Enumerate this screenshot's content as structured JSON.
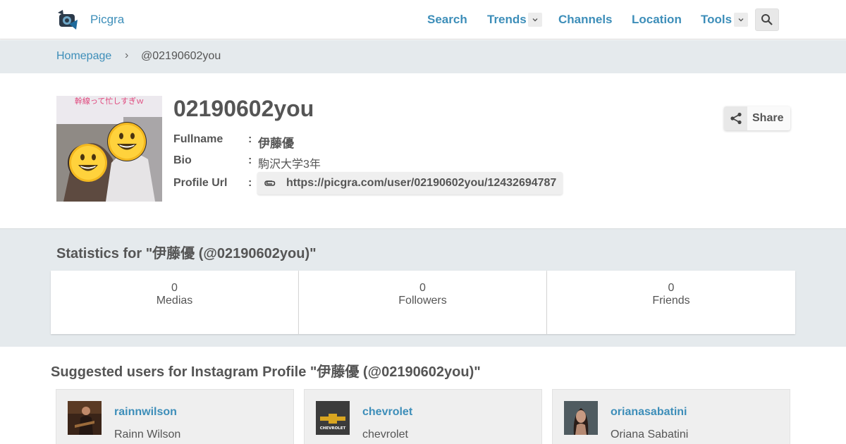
{
  "nav": {
    "brand": "Picgra",
    "items": [
      {
        "label": "Search"
      },
      {
        "label": "Trends"
      },
      {
        "label": "Channels"
      },
      {
        "label": "Location"
      },
      {
        "label": "Tools"
      }
    ]
  },
  "breadcrumb": {
    "home": "Homepage",
    "separator": "›",
    "current": "@02190602you"
  },
  "profile": {
    "username": "02190602you",
    "avatar_caption": "幹線って忙しすぎｗ",
    "fields": [
      {
        "label": "Fullname",
        "value": "伊藤優"
      },
      {
        "label": "Bio",
        "value": "駒沢大学3年"
      },
      {
        "label": "Profile Url",
        "value": "https://picgra.com/user/02190602you/12432694787"
      }
    ],
    "colon": ":",
    "share_label": "Share"
  },
  "statistics": {
    "title": "Statistics for \"伊藤優 (@02190602you)\"",
    "items": [
      {
        "value": "0",
        "label": "Medias"
      },
      {
        "value": "0",
        "label": "Followers"
      },
      {
        "value": "0",
        "label": "Friends"
      }
    ]
  },
  "suggested": {
    "title": "Suggested users for Instagram Profile \"伊藤優 (@02190602you)\"",
    "users": [
      {
        "username": "rainnwilson",
        "fullname": "Rainn Wilson"
      },
      {
        "username": "chevrolet",
        "fullname": "chevrolet",
        "thumb_text": "CHEVROLET"
      },
      {
        "username": "orianasabatini",
        "fullname": "Oriana Sabatini"
      }
    ]
  },
  "colors": {
    "link": "#3d8eb9",
    "text": "#555555",
    "band": "#e5eaed"
  }
}
